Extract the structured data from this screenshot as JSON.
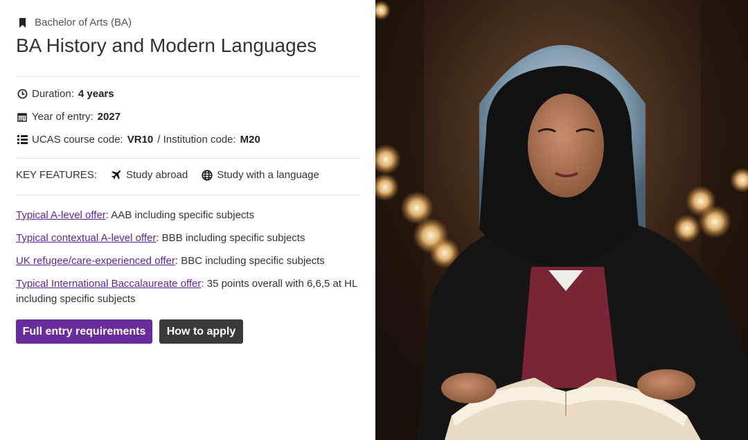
{
  "course": {
    "degree_label": "Bachelor of Arts (BA)",
    "title": "BA History and Modern Languages"
  },
  "details": {
    "duration_label": "Duration:",
    "duration_value": "4 years",
    "entry_label": "Year of entry:",
    "entry_value": "2027",
    "ucas_label": "UCAS course code:",
    "ucas_value": "VR10",
    "separator": "/ Institution code:",
    "institution_value": "M20"
  },
  "key_features": {
    "label": "KEY FEATURES:",
    "items": [
      "Study abroad",
      "Study with a language"
    ]
  },
  "offers": [
    {
      "link": "Typical A-level offer",
      "text": ": AAB including specific subjects"
    },
    {
      "link": "Typical contextual A-level offer",
      "text": ": BBB including specific subjects"
    },
    {
      "link": "UK refugee/care-experienced offer",
      "text": ": BBC including specific subjects"
    },
    {
      "link": "Typical International Baccalaureate offer",
      "text": ": 35 points overall with 6,6,5 at HL including specific subjects"
    }
  ],
  "buttons": {
    "full_entry": "Full entry requirements",
    "how_to_apply": "How to apply"
  },
  "colors": {
    "link": "#5f259f",
    "primary_button": "#6a2c9a",
    "secondary_button": "#3a3a3a"
  },
  "icons": [
    "bookmark-icon",
    "clock-icon",
    "calendar-icon",
    "list-icon",
    "airplane-icon",
    "globe-icon"
  ]
}
